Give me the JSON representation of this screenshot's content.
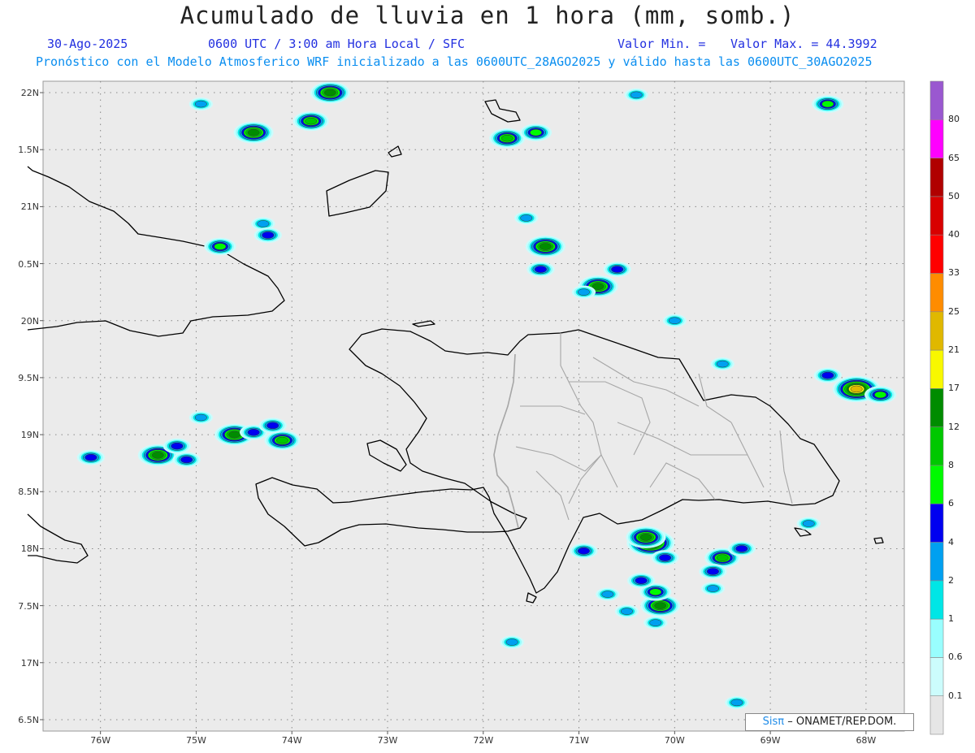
{
  "title": "Acumulado de lluvia en 1 hora (mm, somb.)",
  "date": "30-Ago-2025",
  "time_info": "0600 UTC / 3:00 am Hora Local / SFC",
  "valor_min": "Valor Min. =",
  "valor_max": "Valor Max. = 44.3992",
  "forecast_info": "Pronóstico con el Modelo Atmosferico WRF inicializado a las 0600UTC_28AGO2025 y válido hasta las  0600UTC_30AGO2025",
  "credit": {
    "sis": "Sisπ",
    "org": "– ONAMET/REP.DOM."
  },
  "map": {
    "lon_range": [
      -76.6,
      -67.6
    ],
    "lat_range": [
      16.4,
      22.1
    ],
    "lat_ticks": [
      {
        "value": 22,
        "label": "22N"
      },
      {
        "value": 21.5,
        "label": "1.5N"
      },
      {
        "value": 21,
        "label": "21N"
      },
      {
        "value": 20.5,
        "label": "0.5N"
      },
      {
        "value": 20,
        "label": "20N"
      },
      {
        "value": 19.5,
        "label": "9.5N"
      },
      {
        "value": 19,
        "label": "19N"
      },
      {
        "value": 18.5,
        "label": "8.5N"
      },
      {
        "value": 18,
        "label": "18N"
      },
      {
        "value": 17.5,
        "label": "7.5N"
      },
      {
        "value": 17,
        "label": "17N"
      },
      {
        "value": 16.5,
        "label": "6.5N"
      }
    ],
    "lon_ticks": [
      {
        "value": -76,
        "label": "76W"
      },
      {
        "value": -75,
        "label": "75W"
      },
      {
        "value": -74,
        "label": "74W"
      },
      {
        "value": -73,
        "label": "73W"
      },
      {
        "value": -72,
        "label": "72W"
      },
      {
        "value": -71,
        "label": "71W"
      },
      {
        "value": -70,
        "label": "70W"
      },
      {
        "value": -69,
        "label": "69W"
      },
      {
        "value": -68,
        "label": "68W"
      }
    ],
    "colors": {
      "background": "#ebebeb",
      "coast": "#000000",
      "borders": "#a6a6a6",
      "grid": "#888888"
    }
  },
  "colorbar": {
    "levels": [
      "0.1",
      "0.6",
      "1",
      "2",
      "4",
      "6",
      "8",
      "12",
      "17",
      "21",
      "25",
      "33",
      "40",
      "50",
      "65",
      "80"
    ],
    "colors": [
      "#e6e6e6",
      "#ccfcfc",
      "#99fefe",
      "#00e6e6",
      "#00a0f0",
      "#0000f0",
      "#00fa00",
      "#00c800",
      "#008c00",
      "#f8f800",
      "#e0b800",
      "#ff8c00",
      "#ff0000",
      "#d80000",
      "#b00000",
      "#ff00ff",
      "#9a58d0"
    ]
  },
  "rain_cells": [
    {
      "lon": -73.6,
      "lat": 22.0,
      "intensity": 8
    },
    {
      "lon": -74.4,
      "lat": 21.65,
      "intensity": 8
    },
    {
      "lon": -73.8,
      "lat": 21.75,
      "intensity": 7
    },
    {
      "lon": -74.95,
      "lat": 21.9,
      "intensity": 4
    },
    {
      "lon": -71.75,
      "lat": 21.6,
      "intensity": 7
    },
    {
      "lon": -71.45,
      "lat": 21.65,
      "intensity": 6
    },
    {
      "lon": -68.4,
      "lat": 21.9,
      "intensity": 6
    },
    {
      "lon": -70.4,
      "lat": 21.98,
      "intensity": 4
    },
    {
      "lon": -74.3,
      "lat": 20.85,
      "intensity": 4
    },
    {
      "lon": -74.25,
      "lat": 20.75,
      "intensity": 5
    },
    {
      "lon": -74.75,
      "lat": 20.65,
      "intensity": 6
    },
    {
      "lon": -71.55,
      "lat": 20.9,
      "intensity": 4
    },
    {
      "lon": -71.35,
      "lat": 20.65,
      "intensity": 8
    },
    {
      "lon": -71.4,
      "lat": 20.45,
      "intensity": 5
    },
    {
      "lon": -70.8,
      "lat": 20.3,
      "intensity": 8
    },
    {
      "lon": -70.6,
      "lat": 20.45,
      "intensity": 5
    },
    {
      "lon": -70.95,
      "lat": 20.25,
      "intensity": 4
    },
    {
      "lon": -70.0,
      "lat": 20.0,
      "intensity": 4
    },
    {
      "lon": -68.1,
      "lat": 19.4,
      "intensity": 10
    },
    {
      "lon": -67.85,
      "lat": 19.35,
      "intensity": 6
    },
    {
      "lon": -68.4,
      "lat": 19.52,
      "intensity": 5
    },
    {
      "lon": -69.5,
      "lat": 19.62,
      "intensity": 4
    },
    {
      "lon": -74.1,
      "lat": 18.95,
      "intensity": 7
    },
    {
      "lon": -74.6,
      "lat": 19.0,
      "intensity": 8
    },
    {
      "lon": -74.4,
      "lat": 19.02,
      "intensity": 5
    },
    {
      "lon": -74.2,
      "lat": 19.08,
      "intensity": 5
    },
    {
      "lon": -74.95,
      "lat": 19.15,
      "intensity": 4
    },
    {
      "lon": -75.4,
      "lat": 18.82,
      "intensity": 8
    },
    {
      "lon": -75.2,
      "lat": 18.9,
      "intensity": 5
    },
    {
      "lon": -75.1,
      "lat": 18.78,
      "intensity": 5
    },
    {
      "lon": -76.1,
      "lat": 18.8,
      "intensity": 5
    },
    {
      "lon": -70.25,
      "lat": 18.05,
      "intensity": 10
    },
    {
      "lon": -70.3,
      "lat": 18.1,
      "intensity": 8
    },
    {
      "lon": -70.1,
      "lat": 17.92,
      "intensity": 5
    },
    {
      "lon": -69.5,
      "lat": 17.92,
      "intensity": 7
    },
    {
      "lon": -69.6,
      "lat": 17.8,
      "intensity": 5
    },
    {
      "lon": -69.3,
      "lat": 18.0,
      "intensity": 5
    },
    {
      "lon": -69.6,
      "lat": 17.65,
      "intensity": 4
    },
    {
      "lon": -70.15,
      "lat": 17.5,
      "intensity": 8
    },
    {
      "lon": -70.2,
      "lat": 17.62,
      "intensity": 6
    },
    {
      "lon": -70.35,
      "lat": 17.72,
      "intensity": 5
    },
    {
      "lon": -70.5,
      "lat": 17.45,
      "intensity": 4
    },
    {
      "lon": -70.7,
      "lat": 17.6,
      "intensity": 4
    },
    {
      "lon": -70.2,
      "lat": 17.35,
      "intensity": 4
    },
    {
      "lon": -70.95,
      "lat": 17.98,
      "intensity": 5
    },
    {
      "lon": -68.6,
      "lat": 18.22,
      "intensity": 4
    },
    {
      "lon": -71.7,
      "lat": 17.18,
      "intensity": 4
    },
    {
      "lon": -69.35,
      "lat": 16.65,
      "intensity": 4
    }
  ]
}
